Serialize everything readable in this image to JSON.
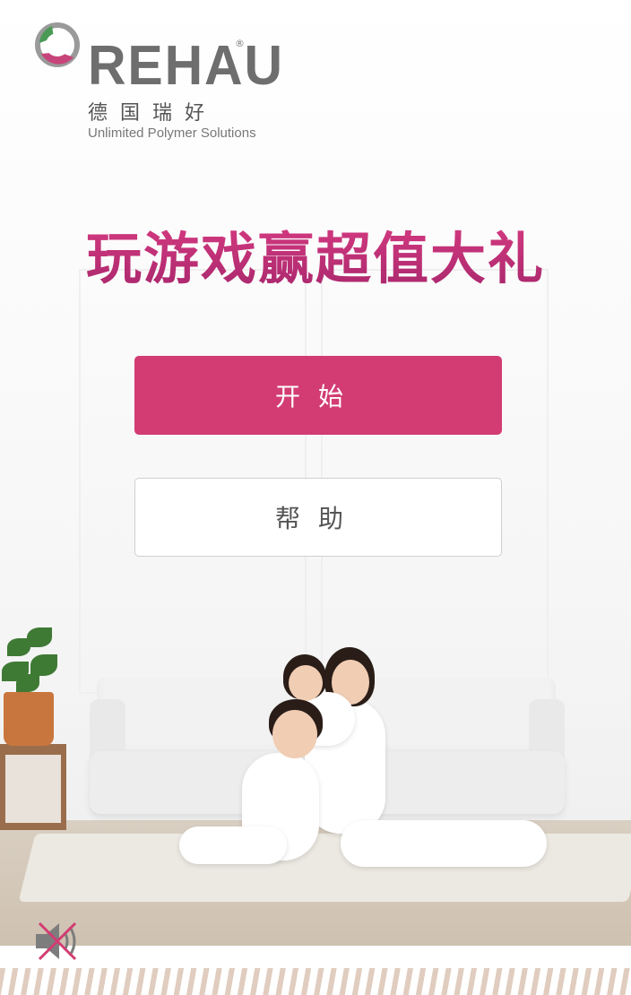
{
  "brand": {
    "name": "REHAU",
    "registered_mark": "®",
    "chinese_name": "德国瑞好",
    "tagline": "Unlimited Polymer Solutions"
  },
  "headline": "玩游戏赢超值大礼",
  "buttons": {
    "start_label": "开始",
    "help_label": "帮助"
  },
  "colors": {
    "accent": "#d23c72",
    "headline": "#c7347a",
    "logo_green": "#4a9a55",
    "logo_pink": "#c7447a"
  },
  "icons": {
    "sound": "muted-speaker-icon"
  }
}
